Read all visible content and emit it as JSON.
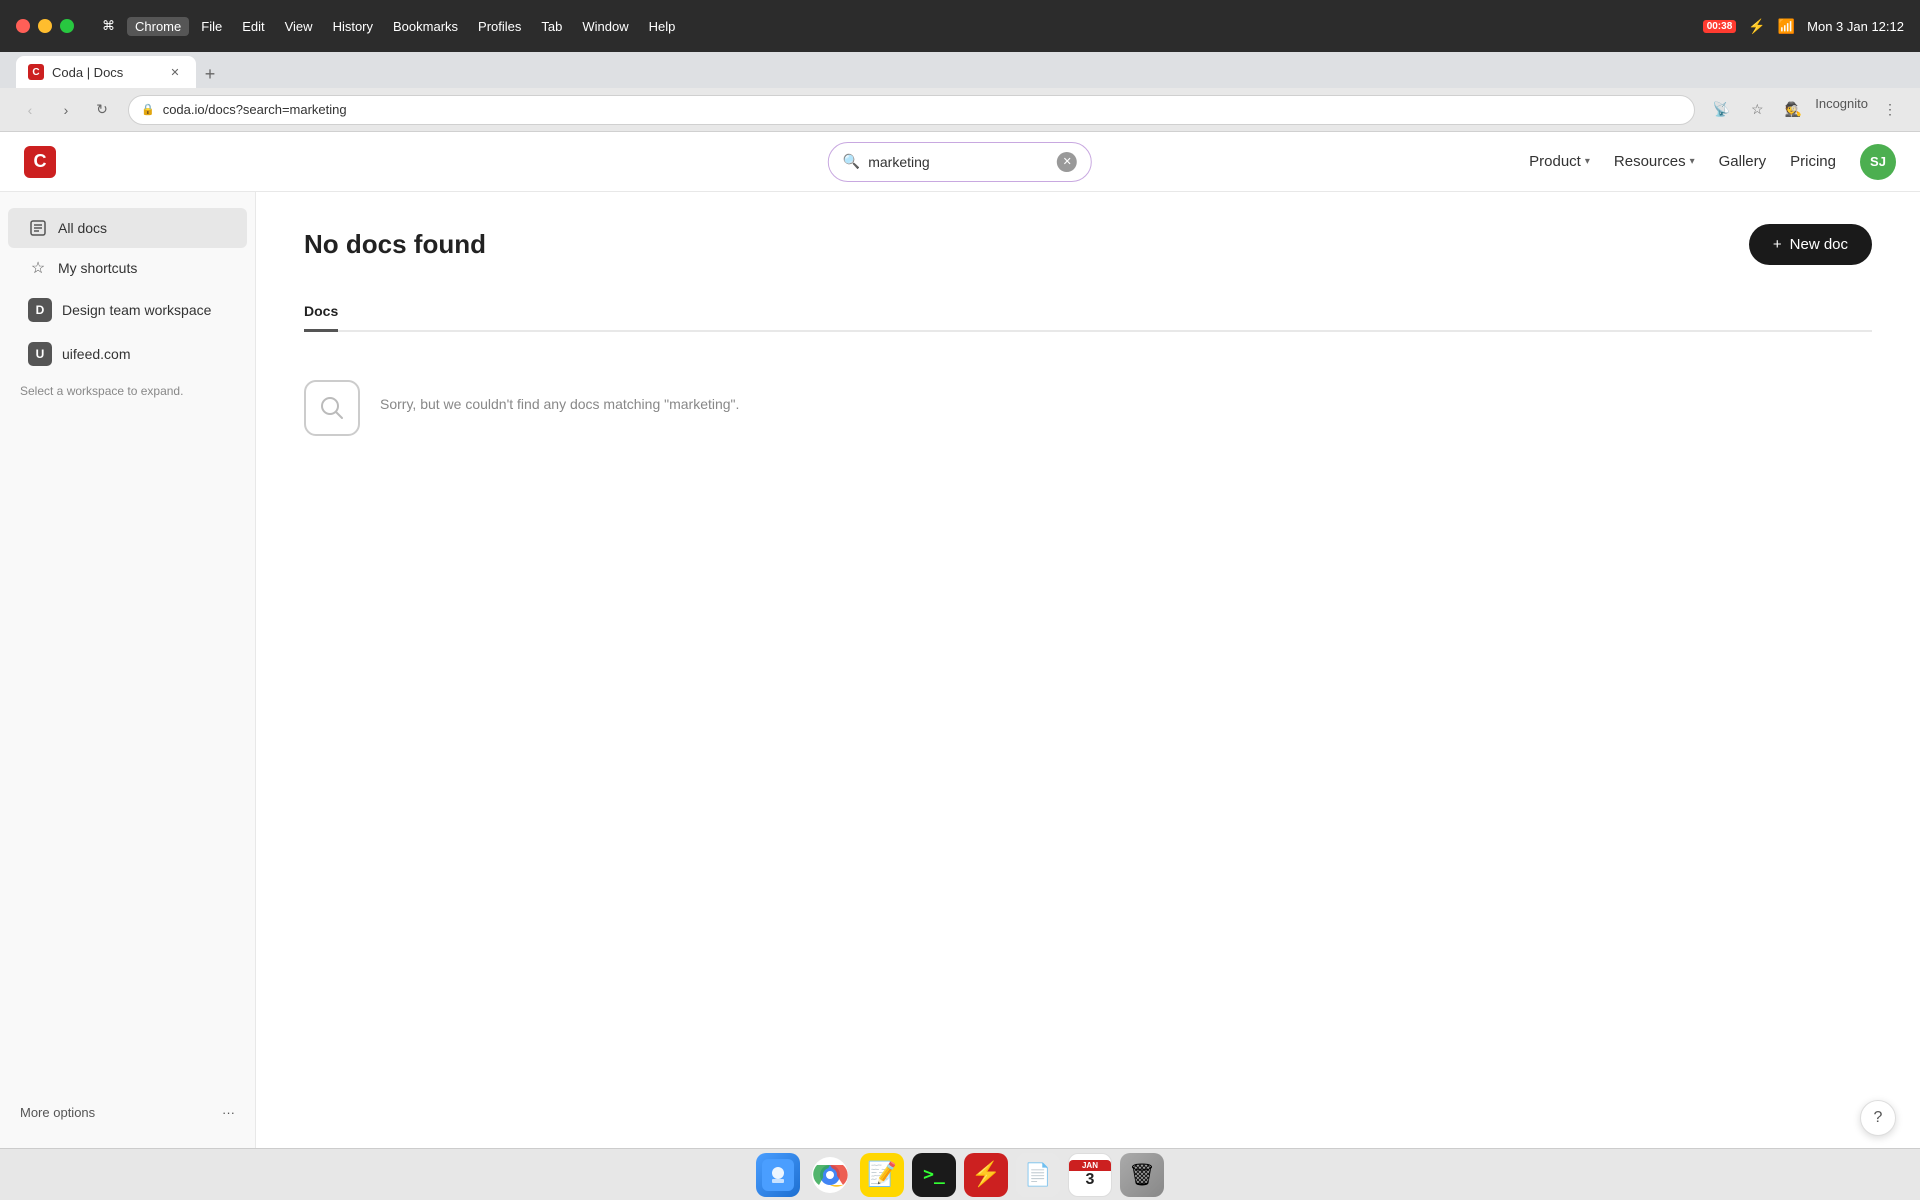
{
  "os": {
    "menubar": {
      "apple": "⌘",
      "items": [
        "Chrome",
        "File",
        "Edit",
        "View",
        "History",
        "Bookmarks",
        "Profiles",
        "Tab",
        "Window",
        "Help"
      ],
      "active_item": "Chrome"
    },
    "status": {
      "battery_time": "00:38",
      "wifi": true,
      "time": "Mon 3 Jan  12:12"
    },
    "dock": {
      "items": [
        {
          "name": "Finder",
          "icon": "🔵"
        },
        {
          "name": "Chrome",
          "icon": "🌐"
        },
        {
          "name": "Notes",
          "icon": "📝"
        },
        {
          "name": "Terminal",
          "icon": "⚫"
        },
        {
          "name": "Bolt",
          "icon": "⚡"
        },
        {
          "name": "TextEdit",
          "icon": "📄"
        },
        {
          "name": "Calendar",
          "icon": "📅"
        },
        {
          "name": "Trash",
          "icon": "🗑"
        }
      ]
    }
  },
  "browser": {
    "tab_title": "Coda | Docs",
    "url": "coda.io/docs?search=marketing",
    "tab_favicon": "C"
  },
  "navbar": {
    "logo_letter": "C",
    "search_value": "marketing",
    "search_placeholder": "Search",
    "nav_links": [
      {
        "label": "Product",
        "has_dropdown": true
      },
      {
        "label": "Resources",
        "has_dropdown": true
      },
      {
        "label": "Gallery",
        "has_dropdown": false
      },
      {
        "label": "Pricing",
        "has_dropdown": false
      }
    ],
    "user_initials": "SJ"
  },
  "sidebar": {
    "items": [
      {
        "label": "All docs",
        "icon": "doc",
        "active": true
      },
      {
        "label": "My shortcuts",
        "icon": "star",
        "active": false
      },
      {
        "label": "Design team workspace",
        "icon": "D",
        "is_workspace": true,
        "active": false
      },
      {
        "label": "uifeed.com",
        "icon": "U",
        "is_workspace": true,
        "active": false
      }
    ],
    "hint": "Select a workspace to expand.",
    "more_options_label": "More options",
    "more_options_icon": "···"
  },
  "main": {
    "page_title": "No docs found",
    "new_doc_label": "New doc",
    "tabs": [
      {
        "label": "Docs",
        "active": true
      }
    ],
    "empty_state": {
      "message": "Sorry, but we couldn't find any docs matching \"marketing\"."
    }
  },
  "help_button": "?"
}
